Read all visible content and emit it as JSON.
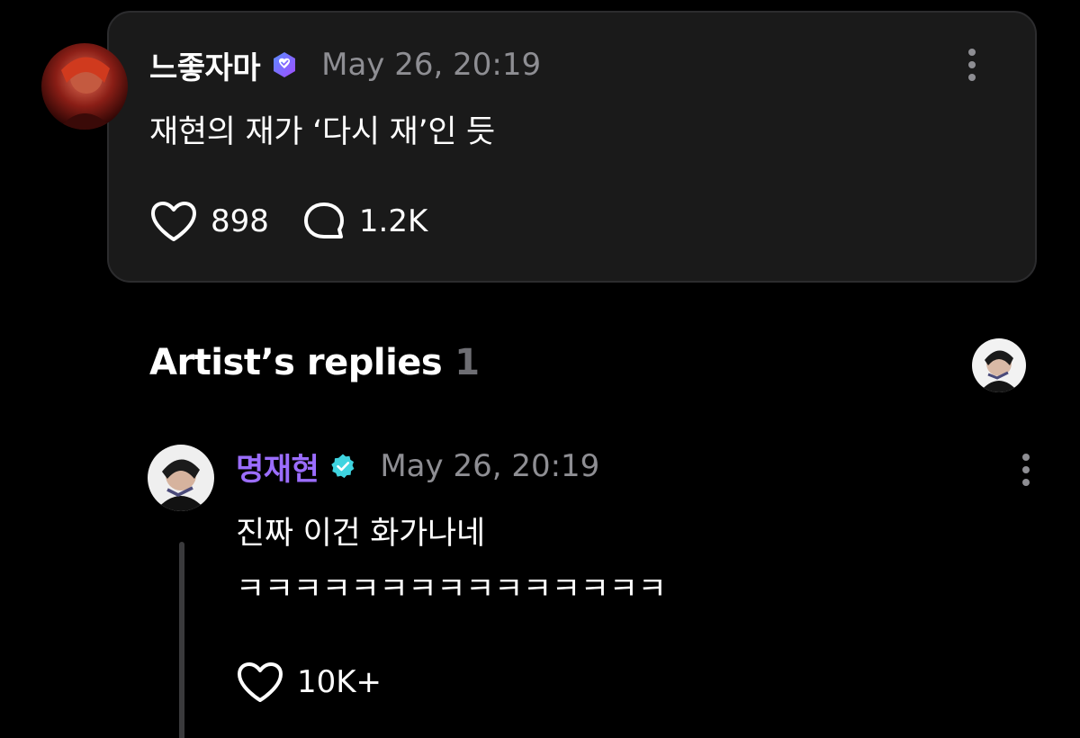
{
  "post": {
    "username": "느좋자마",
    "timestamp": "May 26, 20:19",
    "text": "재현의 재가 ‘다시 재’인 듯",
    "likes": "898",
    "comments": "1.2K",
    "verified_icon": "verified-badge-icon",
    "verified_color": "#7b5cff"
  },
  "artist_replies": {
    "title": "Artist’s replies",
    "count": "1"
  },
  "reply": {
    "username": "명재현",
    "username_color": "#9b6dff",
    "timestamp": "May 26, 20:19",
    "text_line1": "진짜 이건 화가나네",
    "text_line2": "ㅋㅋㅋㅋㅋㅋㅋㅋㅋㅋㅋㅋㅋㅋㅋ",
    "likes": "10K+",
    "verified_icon": "verified-check-icon",
    "verified_color": "#3fd4e0"
  },
  "colors": {
    "background": "#000000",
    "card": "#1a1a1a",
    "secondary_text": "#8e8e93"
  }
}
